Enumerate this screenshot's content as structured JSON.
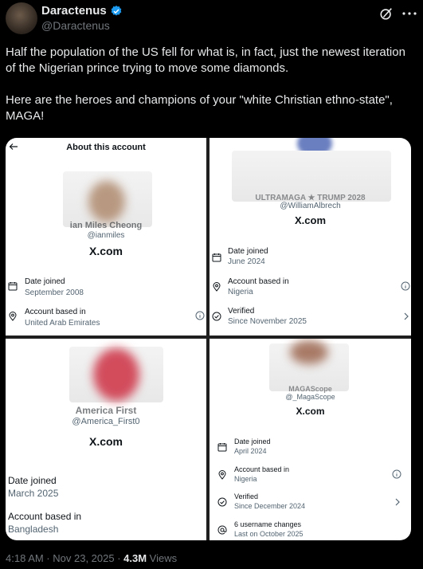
{
  "author": {
    "name": "Daractenus",
    "handle": "@Daractenus"
  },
  "tweet": {
    "text": "Half the population of the US fell for what is, in fact, just the newest iteration of the Nigerian prince trying to move some diamonds.\n\nHere are the heroes and champions of your \"white Christian ethno-state\", MAGA!"
  },
  "panels": {
    "p1": {
      "title": "About this account",
      "name_partial": "ian Miles Cheong",
      "handle": "@ianmiles",
      "site": "X.com",
      "date_label": "Date joined",
      "date_value": "September 2008",
      "based_label": "Account based in",
      "based_value": "United Arab Emirates"
    },
    "p2": {
      "name_partial": "ULTRAMAGA ★ TRUMP 2028",
      "handle": "@WilliamAlbrech",
      "site": "X.com",
      "date_label": "Date joined",
      "date_value": "June 2024",
      "based_label": "Account based in",
      "based_value": "Nigeria",
      "verified_label": "Verified",
      "verified_value": "Since November 2025"
    },
    "p3": {
      "name_partial": "America First",
      "handle": "@America_First0",
      "site": "X.com",
      "date_label": "Date joined",
      "date_value": "March 2025",
      "based_label": "Account based in",
      "based_value": "Bangladesh"
    },
    "p4": {
      "name_partial": "MAGAScope",
      "handle": "@_MagaScope",
      "site": "X.com",
      "date_label": "Date joined",
      "date_value": "April 2024",
      "based_label": "Account based in",
      "based_value": "Nigeria",
      "verified_label": "Verified",
      "verified_value": "Since December 2024",
      "username_label": "6 username changes",
      "username_value": "Last on October 2025"
    }
  },
  "footer": {
    "time": "4:18 AM · Nov 23, 2025 · ",
    "views_count": "4.3M",
    "views_label": " Views"
  },
  "colors": {
    "verified": "#1d9bf0",
    "background": "#000000",
    "muted": "#71767b"
  },
  "icons": [
    "verified-badge-icon",
    "grok-icon",
    "more-icon",
    "back-arrow-icon",
    "calendar-icon",
    "location-icon",
    "info-icon",
    "verified-check-icon",
    "chevron-right-icon",
    "at-icon"
  ]
}
